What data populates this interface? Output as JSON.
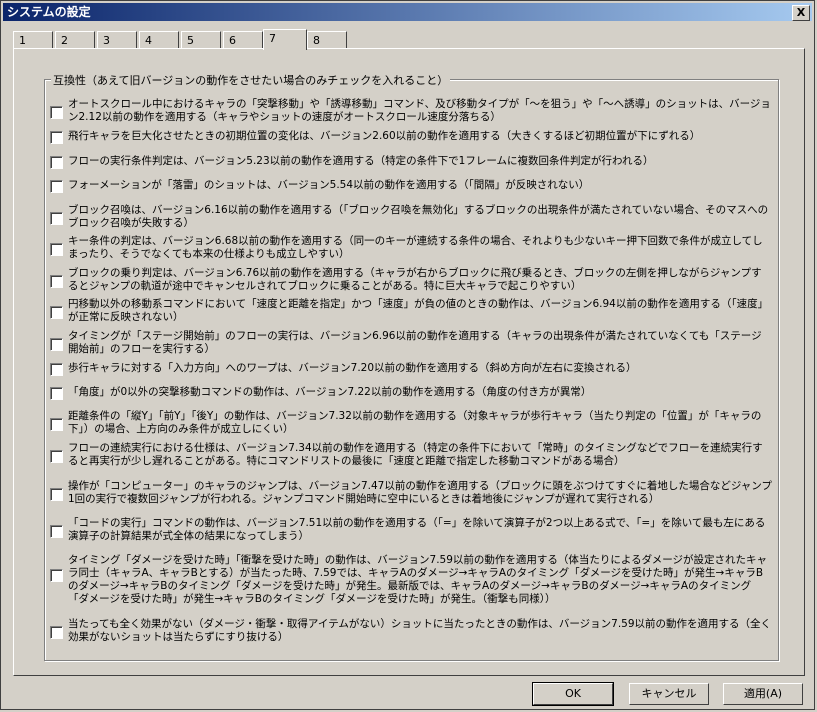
{
  "window": {
    "title": "システムの設定",
    "close_label": "X"
  },
  "tabs": [
    "1",
    "2",
    "3",
    "4",
    "5",
    "6",
    "7",
    "8"
  ],
  "active_tab": "7",
  "group": {
    "title": "互換性（あえて旧バージョンの動作をさせたい場合のみチェックを入れること）",
    "options": [
      {
        "text": "オートスクロール中におけるキャラの「突撃移動」や「誘導移動」コマンド、及び移動タイプが「～を狙う」や「～へ誘導」のショットは、バージョン2.12以前の動作を適用する（キャラやショットの速度がオートスクロール速度分落ちる）",
        "checked": false
      },
      {
        "text": "飛行キャラを巨大化させたときの初期位置の変化は、バージョン2.60以前の動作を適用する（大きくするほど初期位置が下にずれる）",
        "checked": false
      },
      {
        "text": "フローの実行条件判定は、バージョン5.23以前の動作を適用する（特定の条件下で1フレームに複数回条件判定が行われる）",
        "checked": false
      },
      {
        "text": "フォーメーションが「落雷」のショットは、バージョン5.54以前の動作を適用する（「間隔」が反映されない）",
        "checked": false
      },
      {
        "text": "ブロック召喚は、バージョン6.16以前の動作を適用する（「ブロック召喚を無効化」するブロックの出現条件が満たされていない場合、そのマスへのブロック召喚が失敗する）",
        "checked": false
      },
      {
        "text": "キー条件の判定は、バージョン6.68以前の動作を適用する（同一のキーが連続する条件の場合、それよりも少ないキー押下回数で条件が成立してしまったり、そうでなくても本来の仕様よりも成立しやすい）",
        "checked": false
      },
      {
        "text": "ブロックの乗り判定は、バージョン6.76以前の動作を適用する（キャラが右からブロックに飛び乗るとき、ブロックの左側を押しながらジャンプするとジャンプの軌道が途中でキャンセルされてブロックに乗ることがある。特に巨大キャラで起こりやすい）",
        "checked": false
      },
      {
        "text": "円移動以外の移動系コマンドにおいて「速度と距離を指定」かつ「速度」が負の値のときの動作は、バージョン6.94以前の動作を適用する（「速度」が正常に反映されない）",
        "checked": false
      },
      {
        "text": "タイミングが「ステージ開始前」のフローの実行は、バージョン6.96以前の動作を適用する（キャラの出現条件が満たされていなくても「ステージ開始前」のフローを実行する）",
        "checked": false
      },
      {
        "text": "歩行キャラに対する「入力方向」へのワープは、バージョン7.20以前の動作を適用する（斜め方向が左右に変換される）",
        "checked": false
      },
      {
        "text": "「角度」が0以外の突撃移動コマンドの動作は、バージョン7.22以前の動作を適用する（角度の付き方が異常）",
        "checked": false
      },
      {
        "text": "距離条件の「縦Y」「前Y」「後Y」の動作は、バージョン7.32以前の動作を適用する（対象キャラが歩行キャラ（当たり判定の「位置」が「キャラの下」）の場合、上方向のみ条件が成立しにくい）",
        "checked": false
      },
      {
        "text": "フローの連続実行における仕様は、バージョン7.34以前の動作を適用する（特定の条件下において「常時」のタイミングなどでフローを連続実行すると再実行が少し遅れることがある。特にコマンドリストの最後に「速度と距離で指定した移動コマンドがある場合）",
        "checked": false
      },
      {
        "text": "操作が「コンピューター」のキャラのジャンプは、バージョン7.47以前の動作を適用する（ブロックに頭をぶつけてすぐに着地した場合などジャンプ1回の実行で複数回ジャンプが行われる。ジャンプコマンド開始時に空中にいるときは着地後にジャンプが遅れて実行される）",
        "checked": false
      },
      {
        "text": "「コードの実行」コマンドの動作は、バージョン7.51以前の動作を適用する（「=」を除いて演算子が2つ以上ある式で、「=」を除いて最も左にある演算子の計算結果が式全体の結果になってしまう）",
        "checked": false
      },
      {
        "text": "タイミング「ダメージを受けた時」「衝撃を受けた時」の動作は、バージョン7.59以前の動作を適用する（体当たりによるダメージが設定されたキャラ同士（キャラA、キャラBとする）が当たった時、7.59では、キャラAのダメージ→キャラAのタイミング「ダメージを受けた時」が発生→キャラBのダメージ→キャラBのタイミング「ダメージを受けた時」が発生。最新版では、キャラAのダメージ→キャラBのダメージ→キャラAのタイミング「ダメージを受けた時」が発生→キャラBのタイミング「ダメージを受けた時」が発生。（衝撃も同様））",
        "checked": false
      },
      {
        "text": "当たっても全く効果がない（ダメージ・衝撃・取得アイテムがない）ショットに当たったときの動作は、バージョン7.59以前の動作を適用する（全く効果がないショットは当たらずにすり抜ける）",
        "checked": false
      }
    ]
  },
  "buttons": {
    "ok": "OK",
    "cancel": "キャンセル",
    "apply": "適用(A)"
  }
}
